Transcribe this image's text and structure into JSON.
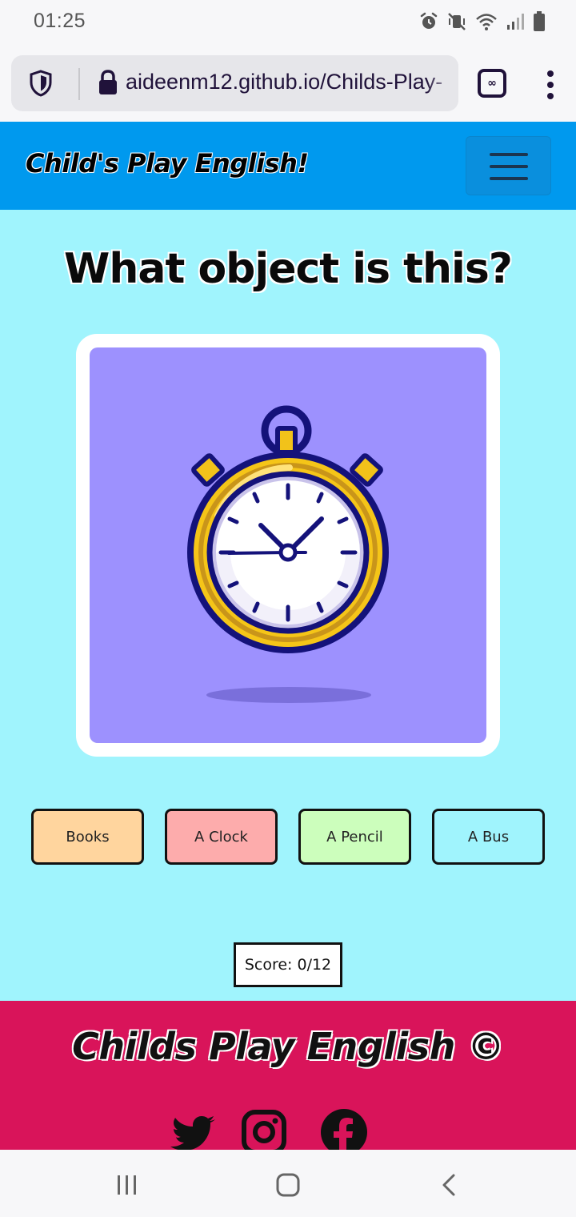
{
  "status_bar": {
    "time": "01:25",
    "icons": [
      "alarm-icon",
      "vibrate-mute-icon",
      "wifi-icon",
      "signal-icon",
      "battery-icon"
    ]
  },
  "browser": {
    "url": "aideenm12.github.io/Childs-Play-",
    "tab_count_symbol": "∞",
    "icons": [
      "shield-icon",
      "lock-icon",
      "tabs-icon",
      "more-vert-icon"
    ]
  },
  "navbar": {
    "brand": "Child's Play English!",
    "toggler_icon": "hamburger-icon"
  },
  "quiz": {
    "question": "What object is this?",
    "image_icon": "stopwatch-icon",
    "answers": [
      {
        "label": "Books",
        "color": "#ffd59e"
      },
      {
        "label": "A Clock",
        "color": "#fdacac"
      },
      {
        "label": "A Pencil",
        "color": "#ccfebc"
      },
      {
        "label": "A Bus",
        "color": "#a0f4fd"
      }
    ],
    "score": "Score: 0/12"
  },
  "footer": {
    "title": "Childs Play English ©",
    "social_icons": [
      "twitter-icon",
      "instagram-icon",
      "facebook-icon"
    ]
  },
  "colors": {
    "navbar": "#0099ee",
    "main_bg": "#a0f4fd",
    "image_bg": "#9d91fe",
    "footer": "#d9145a"
  }
}
